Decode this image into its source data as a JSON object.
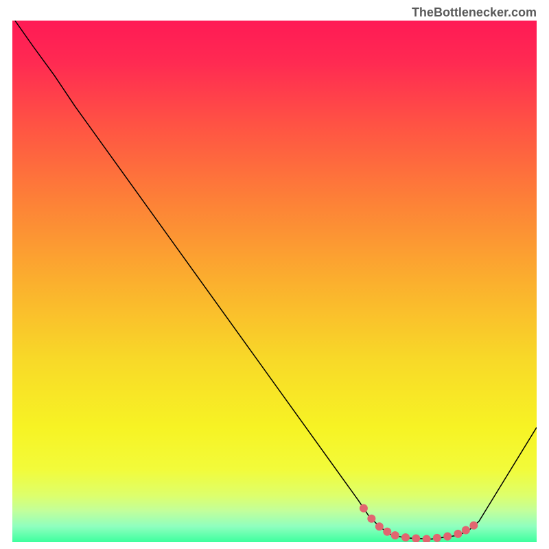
{
  "watermark": "TheBottlenecker.com",
  "chart_data": {
    "type": "line",
    "title": "",
    "xlabel": "",
    "ylabel": "",
    "xlim": [
      0,
      100
    ],
    "ylim": [
      0,
      100
    ],
    "gradient_stops": [
      {
        "offset": 0.0,
        "color": "#ff1a55"
      },
      {
        "offset": 0.08,
        "color": "#ff2a52"
      },
      {
        "offset": 0.2,
        "color": "#ff5344"
      },
      {
        "offset": 0.35,
        "color": "#fd8237"
      },
      {
        "offset": 0.5,
        "color": "#fbaf2e"
      },
      {
        "offset": 0.65,
        "color": "#f8d928"
      },
      {
        "offset": 0.78,
        "color": "#f7f324"
      },
      {
        "offset": 0.86,
        "color": "#f2fb3a"
      },
      {
        "offset": 0.91,
        "color": "#deff6b"
      },
      {
        "offset": 0.94,
        "color": "#c2ff9b"
      },
      {
        "offset": 0.97,
        "color": "#8fffbf"
      },
      {
        "offset": 1.0,
        "color": "#3dff9e"
      }
    ],
    "series": [
      {
        "name": "bottleneck-curve",
        "type": "line",
        "color": "#000000",
        "stroke_width": 1.5,
        "points": [
          {
            "x": 0.5,
            "y": 100
          },
          {
            "x": 4,
            "y": 95
          },
          {
            "x": 8,
            "y": 89.5
          },
          {
            "x": 12,
            "y": 83.5
          },
          {
            "x": 66,
            "y": 8
          },
          {
            "x": 68,
            "y": 5
          },
          {
            "x": 70,
            "y": 3
          },
          {
            "x": 72,
            "y": 1.5
          },
          {
            "x": 75,
            "y": 0.8
          },
          {
            "x": 80,
            "y": 0.6
          },
          {
            "x": 85,
            "y": 1.3
          },
          {
            "x": 87,
            "y": 2.2
          },
          {
            "x": 89,
            "y": 4
          },
          {
            "x": 100,
            "y": 22
          }
        ]
      },
      {
        "name": "bottom-highlight-dots",
        "type": "scatter",
        "color": "#e16570",
        "marker_size": 6,
        "points": [
          {
            "x": 67,
            "y": 6.5
          },
          {
            "x": 68.5,
            "y": 4.5
          },
          {
            "x": 70,
            "y": 3
          },
          {
            "x": 71.5,
            "y": 2
          },
          {
            "x": 73,
            "y": 1.3
          },
          {
            "x": 75,
            "y": 0.9
          },
          {
            "x": 77,
            "y": 0.7
          },
          {
            "x": 79,
            "y": 0.6
          },
          {
            "x": 81,
            "y": 0.8
          },
          {
            "x": 83,
            "y": 1.1
          },
          {
            "x": 85,
            "y": 1.6
          },
          {
            "x": 86.5,
            "y": 2.3
          },
          {
            "x": 88,
            "y": 3.2
          }
        ]
      }
    ]
  }
}
